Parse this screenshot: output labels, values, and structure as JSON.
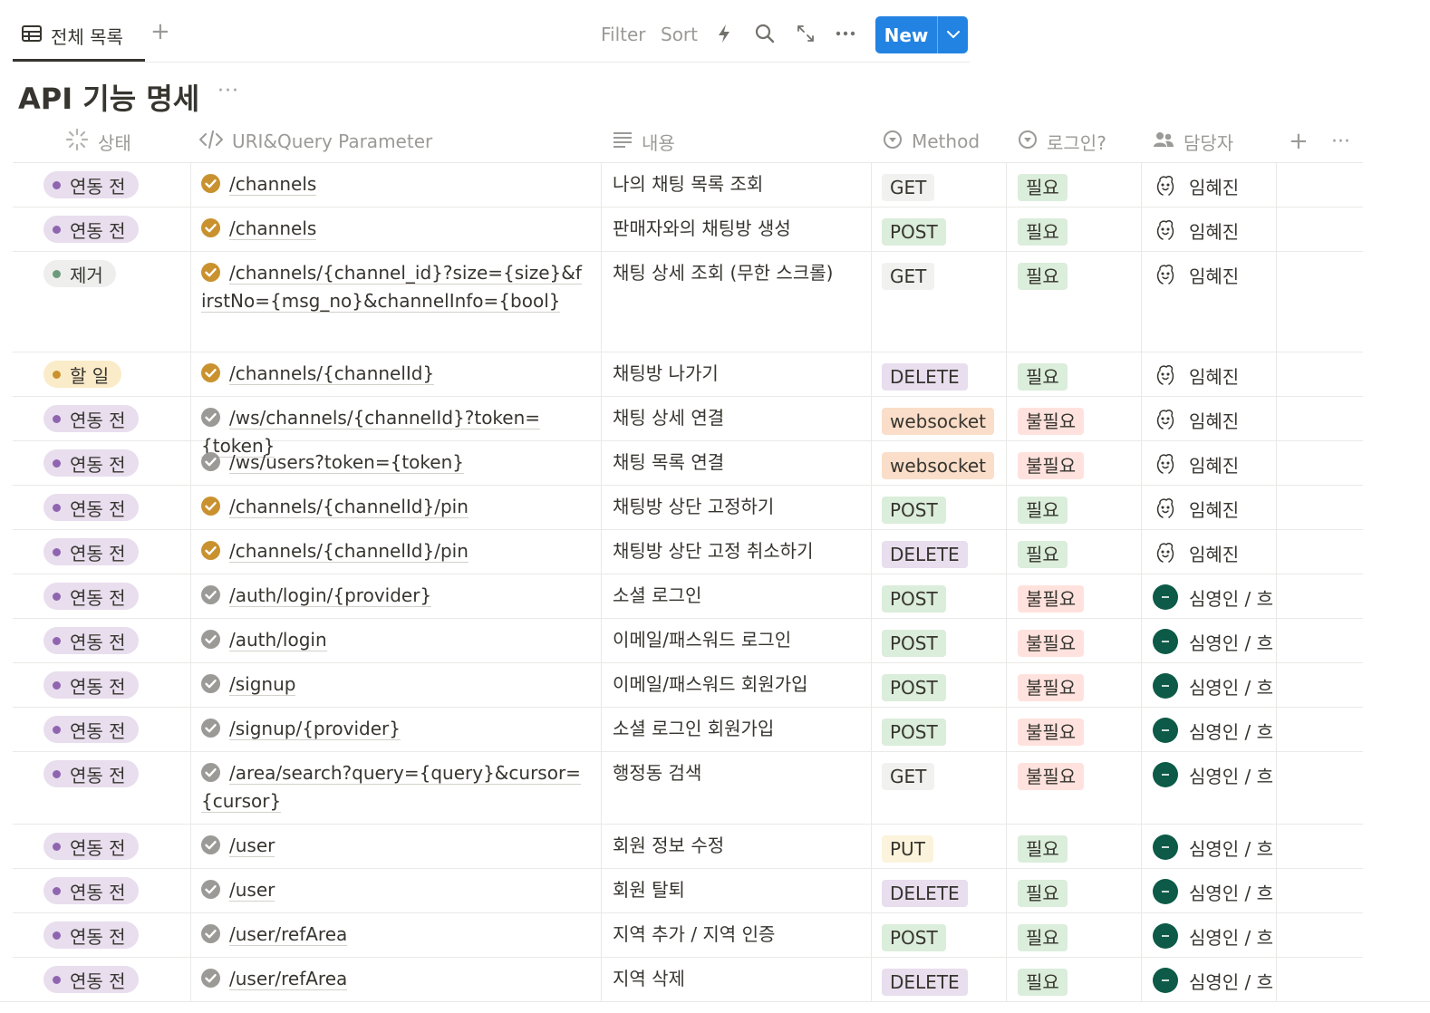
{
  "toolbar": {
    "view_label": "전체 목록",
    "add_view": "+",
    "filter_label": "Filter",
    "sort_label": "Sort",
    "new_label": "New"
  },
  "title": "API 기능 명세",
  "title_more": "···",
  "header": {
    "status": "상태",
    "uri": "URI&Query Parameter",
    "content": "내용",
    "method": "Method",
    "login": "로그인?",
    "assignee": "담당자",
    "add": "+",
    "more": "···"
  },
  "colors": {
    "status": {
      "연동 전": {
        "bg": "#e8deee",
        "dot": "#9065b0"
      },
      "제거": {
        "bg": "#eeeeed",
        "dot": "#6c9b7d"
      },
      "할 일": {
        "bg": "#fbecc9",
        "dot": "#cb912f"
      }
    },
    "method": {
      "GET": {
        "bg": "#f1f1ef"
      },
      "POST": {
        "bg": "#dbeddb"
      },
      "DELETE": {
        "bg": "#e8deee"
      },
      "PUT": {
        "bg": "#fbf3db"
      },
      "websocket": {
        "bg": "#fadec9"
      }
    },
    "login": {
      "필요": {
        "bg": "#dbeddb"
      },
      "불필요": {
        "bg": "#ffe2dd"
      }
    },
    "check": {
      "done": "#c9922f",
      "pending": "#9b9a97"
    },
    "accent": "#2383e2"
  },
  "rows": [
    {
      "status": "연동 전",
      "check": "done",
      "uri": "/channels",
      "content": "나의 채팅 목록 조회",
      "method": "GET",
      "login": "필요",
      "assignee": "임혜진",
      "avatar": "sketch"
    },
    {
      "status": "연동 전",
      "check": "done",
      "uri": "/channels",
      "content": "판매자와의 채팅방 생성",
      "method": "POST",
      "login": "필요",
      "assignee": "임혜진",
      "avatar": "sketch"
    },
    {
      "status": "제거",
      "check": "done",
      "uri": "/channels/{channel_id}?size={size}&firstNo={msg_no}&channelInfo={bool}",
      "content": "채팅 상세 조회 (무한 스크롤)",
      "method": "GET",
      "login": "필요",
      "assignee": "임혜진",
      "avatar": "sketch",
      "lines": 3
    },
    {
      "status": "할 일",
      "check": "done",
      "uri": "/channels/{channelId}",
      "content": "채팅방 나가기",
      "method": "DELETE",
      "login": "필요",
      "assignee": "임혜진",
      "avatar": "sketch"
    },
    {
      "status": "연동 전",
      "check": "pending",
      "uri": "/ws/channels/{channelId}?token={token}",
      "content": "채팅 상세 연결",
      "method": "websocket",
      "login": "불필요",
      "assignee": "임혜진",
      "avatar": "sketch"
    },
    {
      "status": "연동 전",
      "check": "pending",
      "uri": "/ws/users?token={token}",
      "content": "채팅 목록 연결",
      "method": "websocket",
      "login": "불필요",
      "assignee": "임혜진",
      "avatar": "sketch"
    },
    {
      "status": "연동 전",
      "check": "done",
      "uri": "/channels/{channelId}/pin",
      "content": "채팅방 상단 고정하기",
      "method": "POST",
      "login": "필요",
      "assignee": "임혜진",
      "avatar": "sketch"
    },
    {
      "status": "연동 전",
      "check": "done",
      "uri": "/channels/{channelId}/pin",
      "content": "채팅방 상단 고정 취소하기",
      "method": "DELETE",
      "login": "필요",
      "assignee": "임혜진",
      "avatar": "sketch"
    },
    {
      "status": "연동 전",
      "check": "pending",
      "uri": "/auth/login/{provider}",
      "content": "소셜 로그인",
      "method": "POST",
      "login": "불필요",
      "assignee": "심영인 / 흐",
      "avatar": "green"
    },
    {
      "status": "연동 전",
      "check": "pending",
      "uri": "/auth/login",
      "content": "이메일/패스워드 로그인",
      "method": "POST",
      "login": "불필요",
      "assignee": "심영인 / 흐",
      "avatar": "green"
    },
    {
      "status": "연동 전",
      "check": "pending",
      "uri": "/signup",
      "content": "이메일/패스워드 회원가입",
      "method": "POST",
      "login": "불필요",
      "assignee": "심영인 / 흐",
      "avatar": "green"
    },
    {
      "status": "연동 전",
      "check": "pending",
      "uri": "/signup/{provider}",
      "content": "소셜 로그인 회원가입",
      "method": "POST",
      "login": "불필요",
      "assignee": "심영인 / 흐",
      "avatar": "green"
    },
    {
      "status": "연동 전",
      "check": "pending",
      "uri": "/area/search?query={query}&cursor={cursor}",
      "content": "행정동 검색",
      "method": "GET",
      "login": "불필요",
      "assignee": "심영인 / 흐",
      "avatar": "green",
      "lines": 2
    },
    {
      "status": "연동 전",
      "check": "pending",
      "uri": "/user",
      "content": "회원 정보 수정",
      "method": "PUT",
      "login": "필요",
      "assignee": "심영인 / 흐",
      "avatar": "green"
    },
    {
      "status": "연동 전",
      "check": "pending",
      "uri": "/user",
      "content": "회원 탈퇴",
      "method": "DELETE",
      "login": "필요",
      "assignee": "심영인 / 흐",
      "avatar": "green"
    },
    {
      "status": "연동 전",
      "check": "pending",
      "uri": "/user/refArea",
      "content": "지역 추가 / 지역 인증",
      "method": "POST",
      "login": "필요",
      "assignee": "심영인 / 흐",
      "avatar": "green"
    },
    {
      "status": "연동 전",
      "check": "pending",
      "uri": "/user/refArea",
      "content": "지역 삭제",
      "method": "DELETE",
      "login": "필요",
      "assignee": "심영인 / 흐",
      "avatar": "green"
    }
  ]
}
